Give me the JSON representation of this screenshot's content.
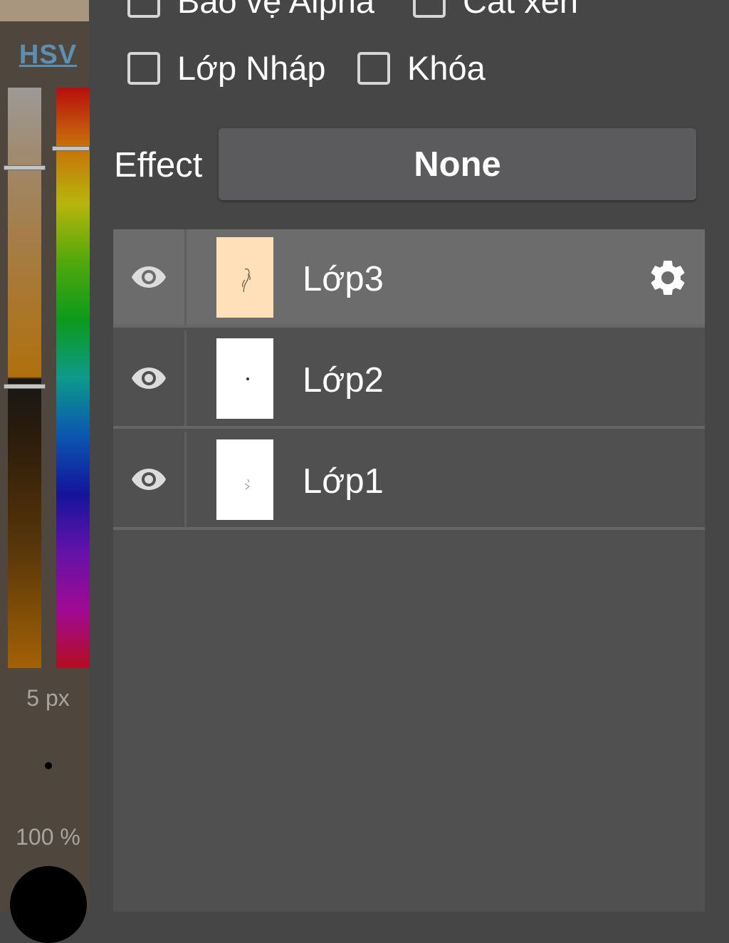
{
  "color_panel": {
    "mode_label": "HSV",
    "brush_size": "5 px",
    "opacity": "100 %",
    "preview_color": "#a8967e",
    "current_color": "#000000"
  },
  "layer_options": {
    "alpha_protect": {
      "label": "Bảo vệ Alpha",
      "checked": false
    },
    "clipping": {
      "label": "Cắt xén",
      "checked": false
    },
    "draft_layer": {
      "label": "Lớp Nháp",
      "checked": false
    },
    "lock": {
      "label": "Khóa",
      "checked": false
    }
  },
  "effect": {
    "label": "Effect",
    "value": "None"
  },
  "layers": [
    {
      "name": "Lớp3",
      "visible": true,
      "selected": true,
      "thumb_bg": "#ffe0b8",
      "icon": "gear-icon"
    },
    {
      "name": "Lớp2",
      "visible": true,
      "selected": false,
      "thumb_bg": "#ffffff"
    },
    {
      "name": "Lớp1",
      "visible": true,
      "selected": false,
      "thumb_bg": "#ffffff"
    }
  ],
  "colors": {
    "background": "#464646",
    "list_bg": "#505050",
    "selected_row": "#6c6c6c",
    "accent_link": "#5b8fb3"
  }
}
